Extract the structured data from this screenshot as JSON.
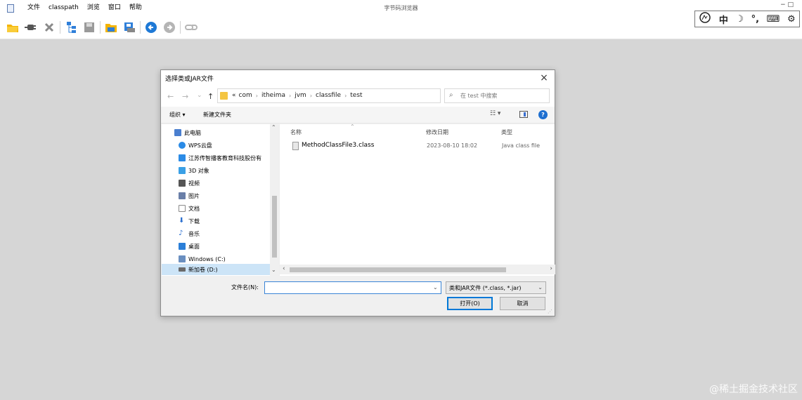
{
  "app": {
    "title": "字节码浏览器",
    "menu": [
      "文件",
      "classpath",
      "浏览",
      "窗口",
      "帮助"
    ],
    "window_controls": "− □"
  },
  "toolbar": {
    "icons": [
      "open-folder-icon",
      "plug-icon",
      "close-x-icon",
      "tree-icon",
      "save-icon",
      "browse-folder-icon",
      "save-all-icon",
      "back-icon",
      "forward-icon",
      "link-icon"
    ]
  },
  "ime": {
    "items": [
      "中",
      "☽",
      "°,",
      "⌨",
      "⚙"
    ]
  },
  "dialog": {
    "title": "选择类或JAR文件",
    "close": "×",
    "nav": {
      "back": "←",
      "forward": "→",
      "recent": "⌄",
      "up": "↑"
    },
    "breadcrumbs": [
      "«",
      "com",
      "itheima",
      "jvm",
      "classfile",
      "test"
    ],
    "refresh": "↻",
    "search_placeholder": "在 test 中搜索",
    "commands": {
      "organize": "组织 ▾",
      "new_folder": "新建文件夹",
      "view": "☷ ▾"
    },
    "tree": [
      {
        "label": "此电脑",
        "color": "#4a7fcf"
      },
      {
        "label": "WPS云盘",
        "color": "#2b8be6"
      },
      {
        "label": "江苏传智播客教育科技股份有",
        "color": "#2b8be6"
      },
      {
        "label": "3D 对象",
        "color": "#3aa0e6"
      },
      {
        "label": "视频",
        "color": "#555555"
      },
      {
        "label": "图片",
        "color": "#6a7fa8"
      },
      {
        "label": "文档",
        "color": "#8a8a8a"
      },
      {
        "label": "下载",
        "color": "#2b6fd0"
      },
      {
        "label": "音乐",
        "color": "#2b6fd0"
      },
      {
        "label": "桌面",
        "color": "#2b7fd8"
      },
      {
        "label": "Windows (C:)",
        "color": "#6a8fc0"
      },
      {
        "label": "新加卷 (D:)",
        "color": "#6a6a6a"
      }
    ],
    "columns": {
      "name": "名称",
      "date": "修改日期",
      "type": "类型"
    },
    "files": [
      {
        "name": "MethodClassFile3.class",
        "date": "2023-08-10 18:02",
        "type": "Java class file"
      }
    ],
    "filename_label": "文件名(N):",
    "filename_value": "",
    "filetype": "类和JAR文件 (*.class, *.jar)",
    "open_button": "打开(O)",
    "cancel_button": "取消"
  },
  "watermark": "@稀土掘金技术社区"
}
